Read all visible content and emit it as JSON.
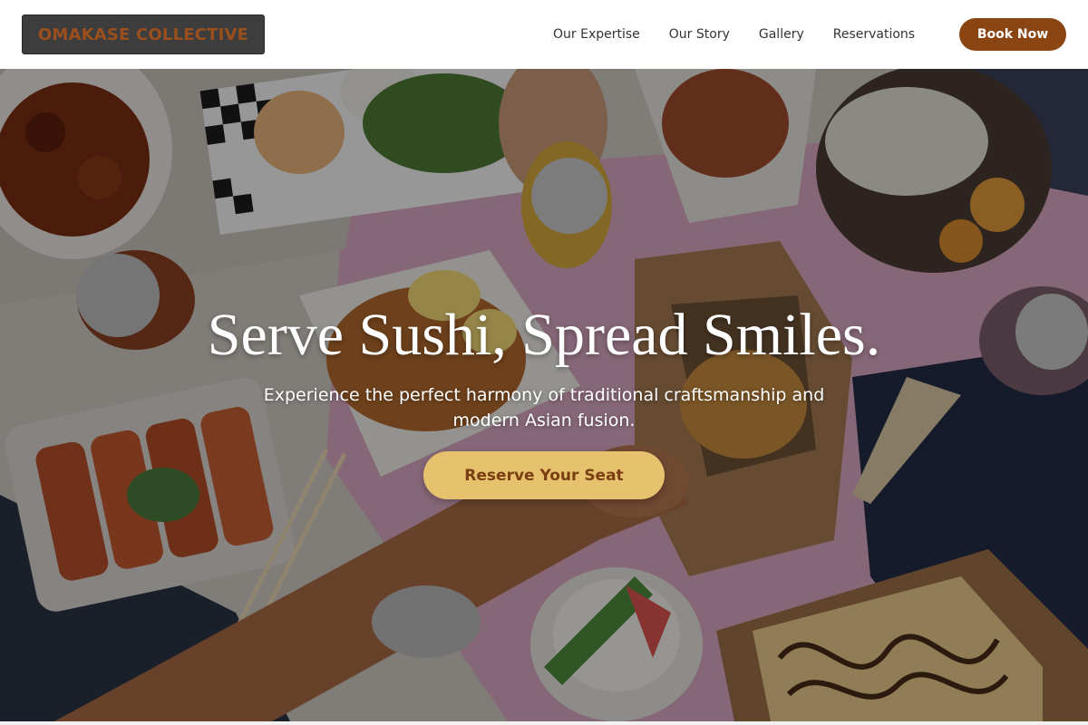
{
  "header": {
    "logo_text": "OMAKASE COLLECTIVE",
    "nav": [
      {
        "label": "Our Expertise"
      },
      {
        "label": "Our Story"
      },
      {
        "label": "Gallery"
      },
      {
        "label": "Reservations"
      }
    ],
    "cta_label": "Book Now"
  },
  "hero": {
    "title": "Serve Sushi, Spread Smiles.",
    "subtitle": "Experience the perfect harmony of traditional craftsmanship and modern Asian fusion.",
    "cta_label": "Reserve Your Seat"
  },
  "colors": {
    "brand_brown": "#8b4513",
    "accent_gold": "#e6c26e",
    "logo_bg": "#3d3d3d"
  }
}
